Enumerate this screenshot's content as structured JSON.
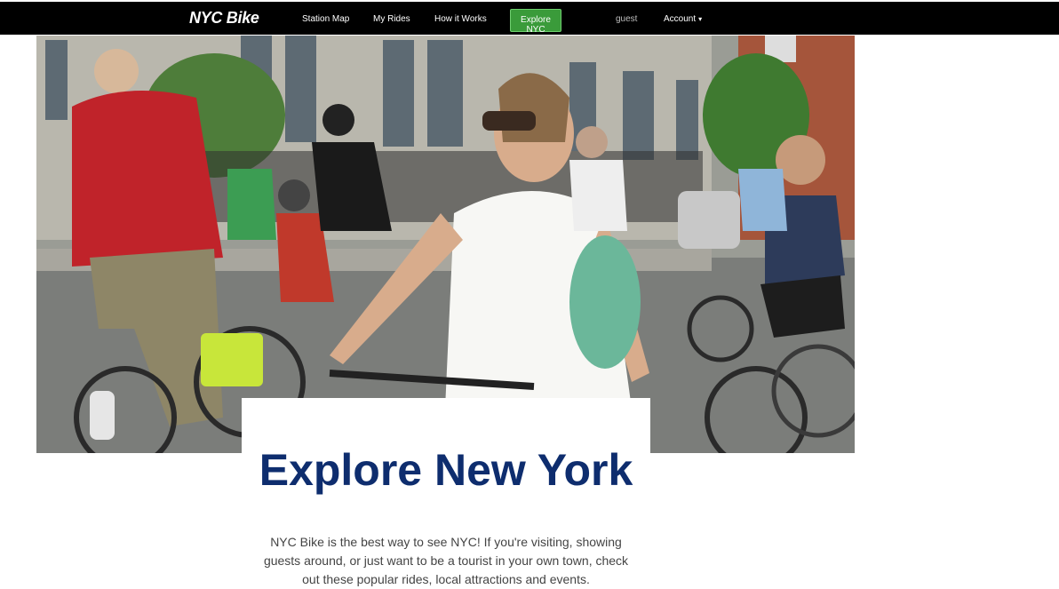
{
  "navbar": {
    "brand": "NYC Bike",
    "links": [
      "Station Map",
      "My Rides",
      "How it Works"
    ],
    "active": "Explore NYC",
    "user": "guest",
    "account": "Account"
  },
  "colors": {
    "navbar_bg": "#000000",
    "active_bg": "#3a9b3a",
    "title": "#0e2d6e"
  },
  "hero": {
    "image": "photo of cyclists riding on a New York City street"
  },
  "main": {
    "title": "Explore New York",
    "description": "NYC Bike is the best way to see NYC! If you're visiting, showing guests around, or just want to be a tourist in your own town, check out these popular rides, local attractions and events."
  }
}
